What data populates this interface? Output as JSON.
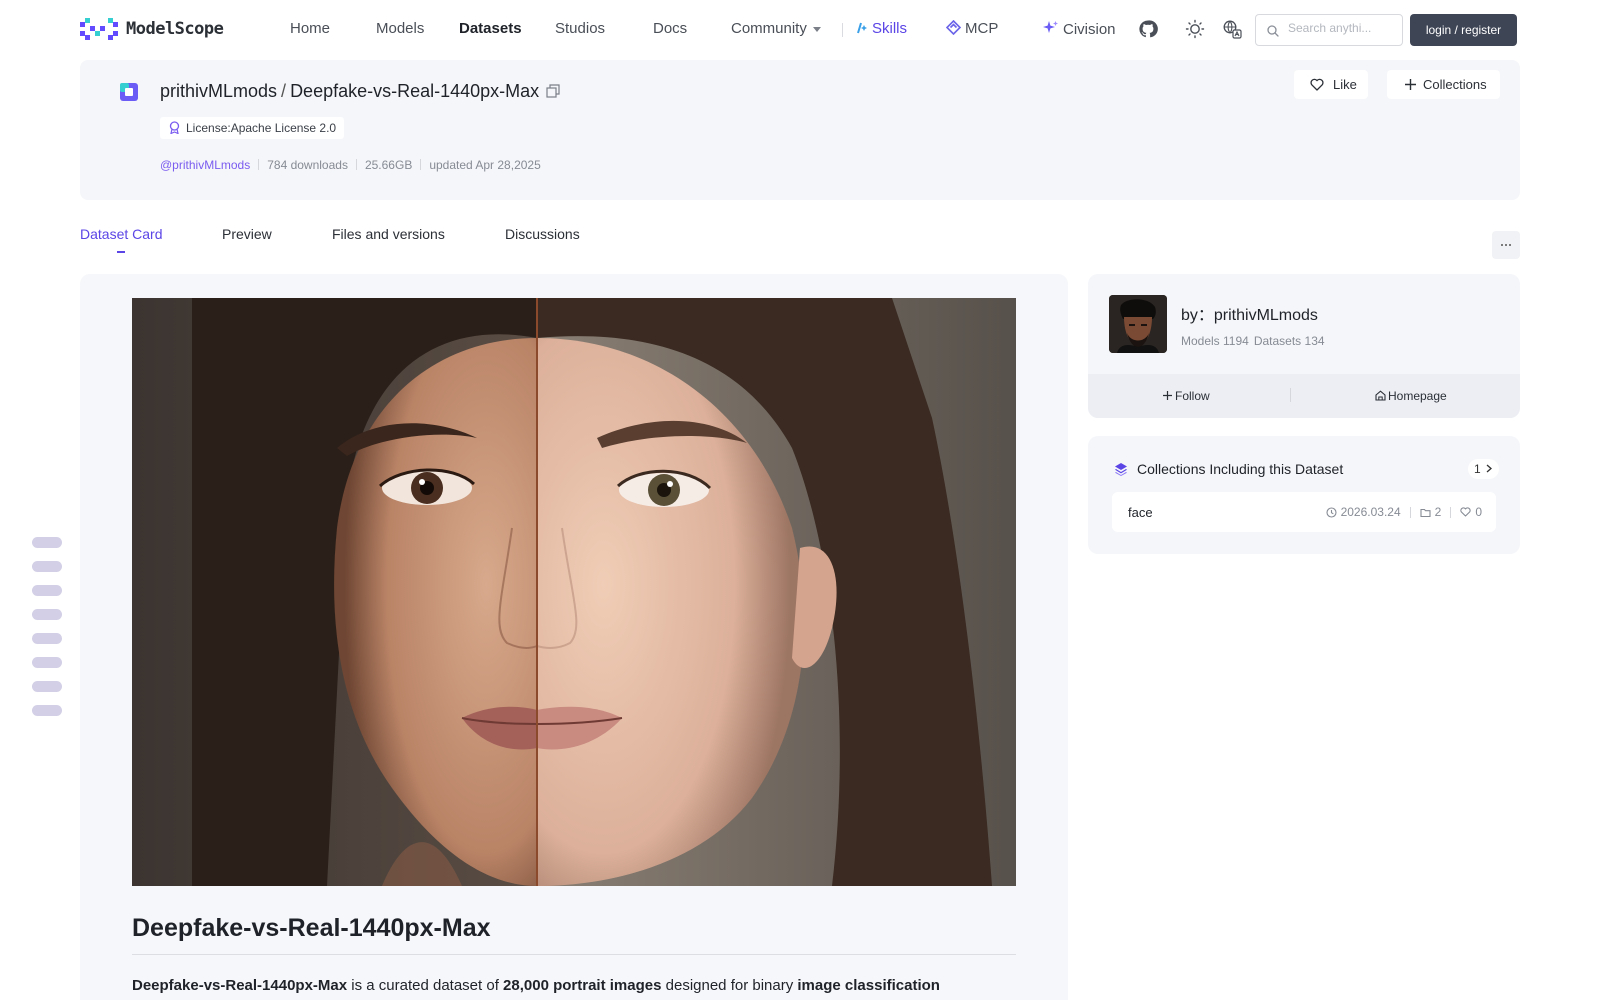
{
  "nav": {
    "logo_text": "ModelScope",
    "items": [
      {
        "label": "Home"
      },
      {
        "label": "Models"
      },
      {
        "label": "Datasets"
      },
      {
        "label": "Studios"
      },
      {
        "label": "Docs"
      },
      {
        "label": "Community"
      },
      {
        "label": "Skills"
      },
      {
        "label": "MCP"
      },
      {
        "label": "Civision"
      }
    ],
    "search_placeholder": "Search anythi...",
    "login_label": "login / register"
  },
  "dataset": {
    "owner": "prithivMLmods",
    "name": "Deepfake-vs-Real-1440px-Max",
    "license": "License:Apache License 2.0",
    "author_handle": "@prithivMLmods",
    "downloads": "784 downloads",
    "size": "25.66GB",
    "updated": "updated Apr 28,2025",
    "like_label": "Like",
    "collections_label": "Collections"
  },
  "tabs": [
    {
      "label": "Dataset Card"
    },
    {
      "label": "Preview"
    },
    {
      "label": "Files and versions"
    },
    {
      "label": "Discussions"
    }
  ],
  "card": {
    "heading": "Deepfake-vs-Real-1440px-Max",
    "intro": {
      "name": "Deepfake-vs-Real-1440px-Max",
      "t1": " is a curated dataset of ",
      "count": "28,000 portrait images",
      "t2": " designed for binary ",
      "task": "image classification"
    }
  },
  "author": {
    "by_label": "by：prithivMLmods",
    "models": "Models 1194",
    "datasets": "Datasets 134",
    "follow_label": "Follow",
    "homepage_label": "Homepage"
  },
  "collections": {
    "title": "Collections Including this Dataset",
    "count": "1",
    "items": [
      {
        "name": "face",
        "date": "2026.03.24",
        "items": "2",
        "likes": "0"
      }
    ]
  },
  "colors": {
    "accent": "#5b45e6",
    "login_bg": "#3e4555",
    "card_bg": "#f5f6f9"
  }
}
